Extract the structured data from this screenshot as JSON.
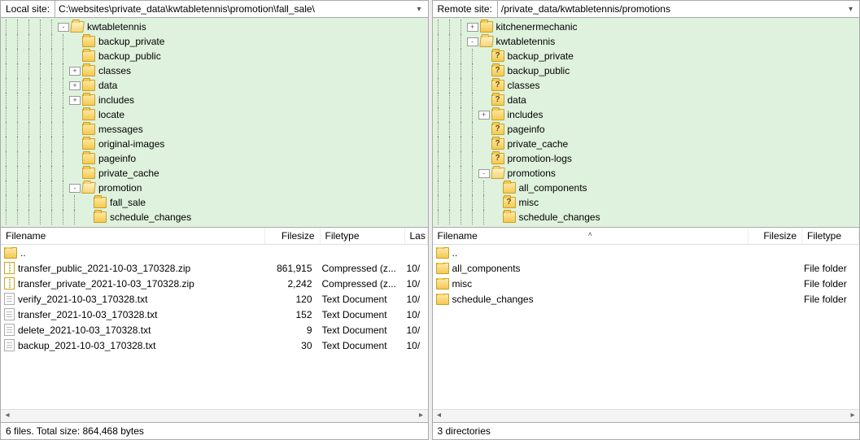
{
  "local": {
    "label": "Local site:",
    "path": "C:\\websites\\private_data\\kwtabletennis\\promotion\\fall_sale\\",
    "tree": [
      {
        "depth": 5,
        "exp": "-",
        "icon": "open",
        "label": "kwtabletennis"
      },
      {
        "depth": 6,
        "exp": "",
        "icon": "closed",
        "label": "backup_private"
      },
      {
        "depth": 6,
        "exp": "",
        "icon": "closed",
        "label": "backup_public"
      },
      {
        "depth": 6,
        "exp": "+",
        "icon": "closed",
        "label": "classes"
      },
      {
        "depth": 6,
        "exp": "+",
        "icon": "closed",
        "label": "data"
      },
      {
        "depth": 6,
        "exp": "+",
        "icon": "closed",
        "label": "includes"
      },
      {
        "depth": 6,
        "exp": "",
        "icon": "closed",
        "label": "locate"
      },
      {
        "depth": 6,
        "exp": "",
        "icon": "closed",
        "label": "messages"
      },
      {
        "depth": 6,
        "exp": "",
        "icon": "closed",
        "label": "original-images"
      },
      {
        "depth": 6,
        "exp": "",
        "icon": "closed",
        "label": "pageinfo"
      },
      {
        "depth": 6,
        "exp": "",
        "icon": "closed",
        "label": "private_cache"
      },
      {
        "depth": 6,
        "exp": "-",
        "icon": "open",
        "label": "promotion"
      },
      {
        "depth": 7,
        "exp": "",
        "icon": "closed",
        "label": "fall_sale"
      },
      {
        "depth": 7,
        "exp": "",
        "icon": "closed",
        "label": "schedule_changes"
      }
    ],
    "cols": {
      "name": "Filename",
      "size": "Filesize",
      "type": "Filetype",
      "mod": "Las"
    },
    "rows": [
      {
        "icon": "closed",
        "name": "..",
        "size": "",
        "type": "",
        "mod": ""
      },
      {
        "icon": "zip",
        "name": "transfer_public_2021-10-03_170328.zip",
        "size": "861,915",
        "type": "Compressed (z...",
        "mod": "10/"
      },
      {
        "icon": "zip",
        "name": "transfer_private_2021-10-03_170328.zip",
        "size": "2,242",
        "type": "Compressed (z...",
        "mod": "10/"
      },
      {
        "icon": "txt",
        "name": "verify_2021-10-03_170328.txt",
        "size": "120",
        "type": "Text Document",
        "mod": "10/"
      },
      {
        "icon": "txt",
        "name": "transfer_2021-10-03_170328.txt",
        "size": "152",
        "type": "Text Document",
        "mod": "10/"
      },
      {
        "icon": "txt",
        "name": "delete_2021-10-03_170328.txt",
        "size": "9",
        "type": "Text Document",
        "mod": "10/"
      },
      {
        "icon": "txt",
        "name": "backup_2021-10-03_170328.txt",
        "size": "30",
        "type": "Text Document",
        "mod": "10/"
      }
    ],
    "status": "6 files. Total size: 864,468 bytes"
  },
  "remote": {
    "label": "Remote site:",
    "path": "/private_data/kwtabletennis/promotions",
    "tree": [
      {
        "depth": 3,
        "exp": "+",
        "icon": "closed",
        "label": "kitchenermechanic"
      },
      {
        "depth": 3,
        "exp": "-",
        "icon": "open",
        "label": "kwtabletennis"
      },
      {
        "depth": 4,
        "exp": "",
        "icon": "q",
        "label": "backup_private"
      },
      {
        "depth": 4,
        "exp": "",
        "icon": "q",
        "label": "backup_public"
      },
      {
        "depth": 4,
        "exp": "",
        "icon": "q",
        "label": "classes"
      },
      {
        "depth": 4,
        "exp": "",
        "icon": "q",
        "label": "data"
      },
      {
        "depth": 4,
        "exp": "+",
        "icon": "closed",
        "label": "includes"
      },
      {
        "depth": 4,
        "exp": "",
        "icon": "q",
        "label": "pageinfo"
      },
      {
        "depth": 4,
        "exp": "",
        "icon": "q",
        "label": "private_cache"
      },
      {
        "depth": 4,
        "exp": "",
        "icon": "q",
        "label": "promotion-logs"
      },
      {
        "depth": 4,
        "exp": "-",
        "icon": "open",
        "label": "promotions"
      },
      {
        "depth": 5,
        "exp": "",
        "icon": "closed",
        "label": "all_components"
      },
      {
        "depth": 5,
        "exp": "",
        "icon": "q",
        "label": "misc"
      },
      {
        "depth": 5,
        "exp": "",
        "icon": "closed",
        "label": "schedule_changes"
      }
    ],
    "cols": {
      "name": "Filename",
      "size": "Filesize",
      "type": "Filetype"
    },
    "rows": [
      {
        "icon": "closed",
        "name": "..",
        "size": "",
        "type": ""
      },
      {
        "icon": "closed",
        "name": "all_components",
        "size": "",
        "type": "File folder"
      },
      {
        "icon": "closed",
        "name": "misc",
        "size": "",
        "type": "File folder"
      },
      {
        "icon": "closed",
        "name": "schedule_changes",
        "size": "",
        "type": "File folder"
      }
    ],
    "status": "3 directories"
  }
}
